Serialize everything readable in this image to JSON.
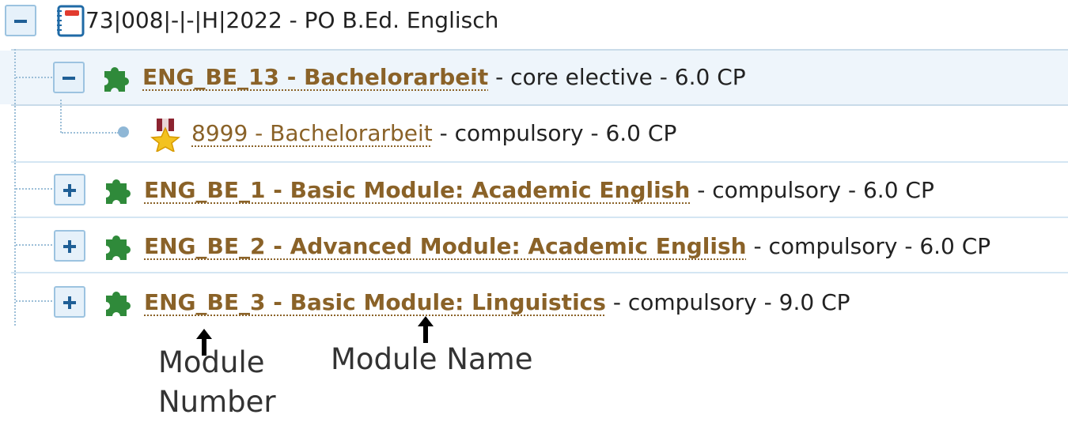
{
  "root": {
    "title": "73|008|-|-|H|2022 - PO B.Ed. Englisch",
    "toggle": "−"
  },
  "items": [
    {
      "code_name": "ENG_BE_13 - Bachelorarbeit",
      "suffix": "- core elective - 6.0 CP",
      "toggle": "−",
      "icon": "puzzle-icon"
    },
    {
      "code_name": "8999 - Bachelorarbeit",
      "suffix": "- compulsory - 6.0 CP",
      "icon": "medal-icon"
    },
    {
      "code_name": "ENG_BE_1 - Basic Module: Academic English",
      "suffix": "- compulsory - 6.0 CP",
      "toggle": "+",
      "icon": "puzzle-icon"
    },
    {
      "code_name": "ENG_BE_2 - Advanced Module: Academic English",
      "suffix": "- compulsory - 6.0 CP",
      "toggle": "+",
      "icon": "puzzle-icon"
    },
    {
      "code_name": "ENG_BE_3 - Basic Module: Linguistics",
      "suffix": "- compulsory - 9.0 CP",
      "toggle": "+",
      "icon": "puzzle-icon"
    }
  ],
  "annotations": {
    "module_number": "Module Number",
    "module_name": "Module Name"
  },
  "colors": {
    "link": "#8a6228",
    "puzzle": "#2f8a3a",
    "toggle_border": "#9cc3e0",
    "toggle_bg": "#e6f1fa"
  }
}
